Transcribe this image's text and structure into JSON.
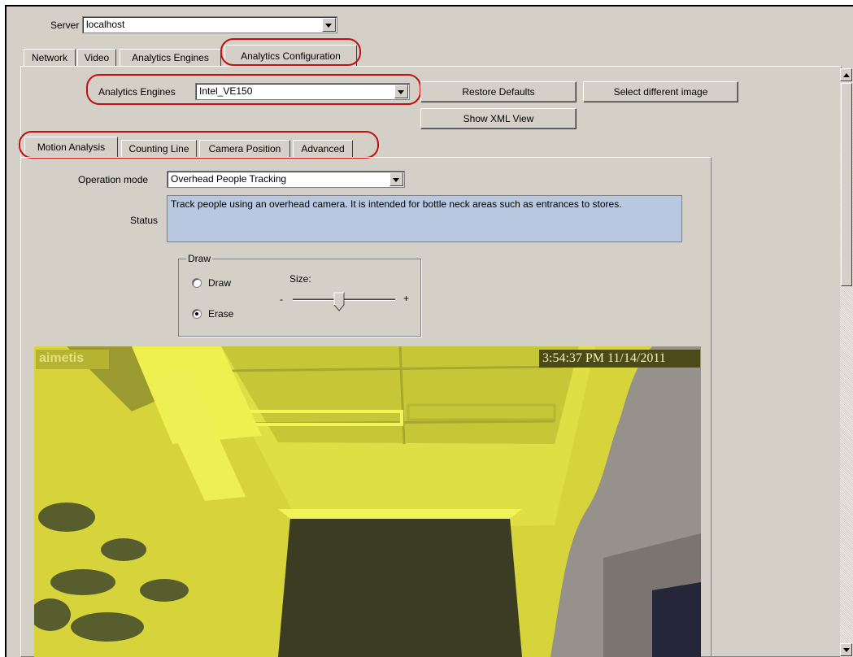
{
  "server": {
    "label": "Server",
    "value": "localhost"
  },
  "main_tabs": [
    {
      "label": "Network"
    },
    {
      "label": "Video"
    },
    {
      "label": "Analytics Engines"
    },
    {
      "label": "Analytics Configuration",
      "active": true
    }
  ],
  "engines": {
    "label": "Analytics Engines",
    "value": "Intel_VE150"
  },
  "buttons": {
    "restore": "Restore Defaults",
    "select_image": "Select different image",
    "xml": "Show XML View"
  },
  "sub_tabs": [
    {
      "label": "Motion Analysis",
      "active": true
    },
    {
      "label": "Counting Line"
    },
    {
      "label": "Camera Position"
    },
    {
      "label": "Advanced"
    }
  ],
  "operation_mode": {
    "label": "Operation mode",
    "value": "Overhead People Tracking"
  },
  "status": {
    "label": "Status",
    "text": "Track people using an overhead camera. It is intended for bottle neck areas such as entrances to stores."
  },
  "draw_group": {
    "title": "Draw",
    "size_label": "Size:",
    "minus": "-",
    "plus": "+",
    "size_value": 0.45,
    "options": [
      {
        "label": "Draw",
        "selected": false
      },
      {
        "label": "Erase",
        "selected": true
      }
    ]
  },
  "video": {
    "watermark": "aimetis",
    "timestamp": "3:54:37 PM 11/14/2011"
  },
  "colors": {
    "highlight_ring": "#c01010",
    "status_bg": "#b7c8e0",
    "mask_yellow": "#e5e600"
  }
}
